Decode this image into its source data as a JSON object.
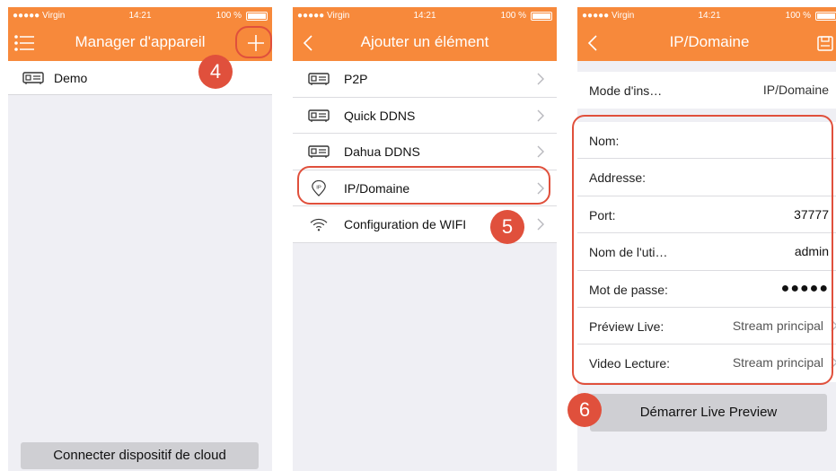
{
  "status": {
    "carrier": "●●●●● Virgin",
    "time": "14:21",
    "battery": "100 %"
  },
  "screen1": {
    "title": "Manager d'appareil",
    "device": "Demo",
    "cloud_button": "Connecter dispositif de cloud",
    "step": "4"
  },
  "screen2": {
    "title": "Ajouter un élément",
    "items": [
      {
        "label": "P2P",
        "icon": "dvr-icon"
      },
      {
        "label": "Quick DDNS",
        "icon": "dvr-icon"
      },
      {
        "label": "Dahua DDNS",
        "icon": "dvr-icon"
      },
      {
        "label": "IP/Domaine",
        "icon": "ip-pin-icon"
      },
      {
        "label": "Configuration de WIFI",
        "icon": "wifi-icon"
      }
    ],
    "step": "5"
  },
  "screen3": {
    "title": "IP/Domaine",
    "mode": {
      "label": "Mode d'ins…",
      "value": "IP/Domaine"
    },
    "fields": [
      {
        "label": "Nom:",
        "value": ""
      },
      {
        "label": "Addresse:",
        "value": ""
      },
      {
        "label": "Port:",
        "value": "37777"
      },
      {
        "label": "Nom de l'uti…",
        "value": "admin"
      },
      {
        "label": "Mot de passe:",
        "value": "●●●●●"
      },
      {
        "label": "Préview Live:",
        "value": "Stream principal"
      },
      {
        "label": "Video Lecture:",
        "value": "Stream principal"
      }
    ],
    "start_button": "Démarrer Live Preview",
    "step": "6"
  },
  "colors": {
    "accent": "#f7893b",
    "annotation": "#e0503c"
  }
}
